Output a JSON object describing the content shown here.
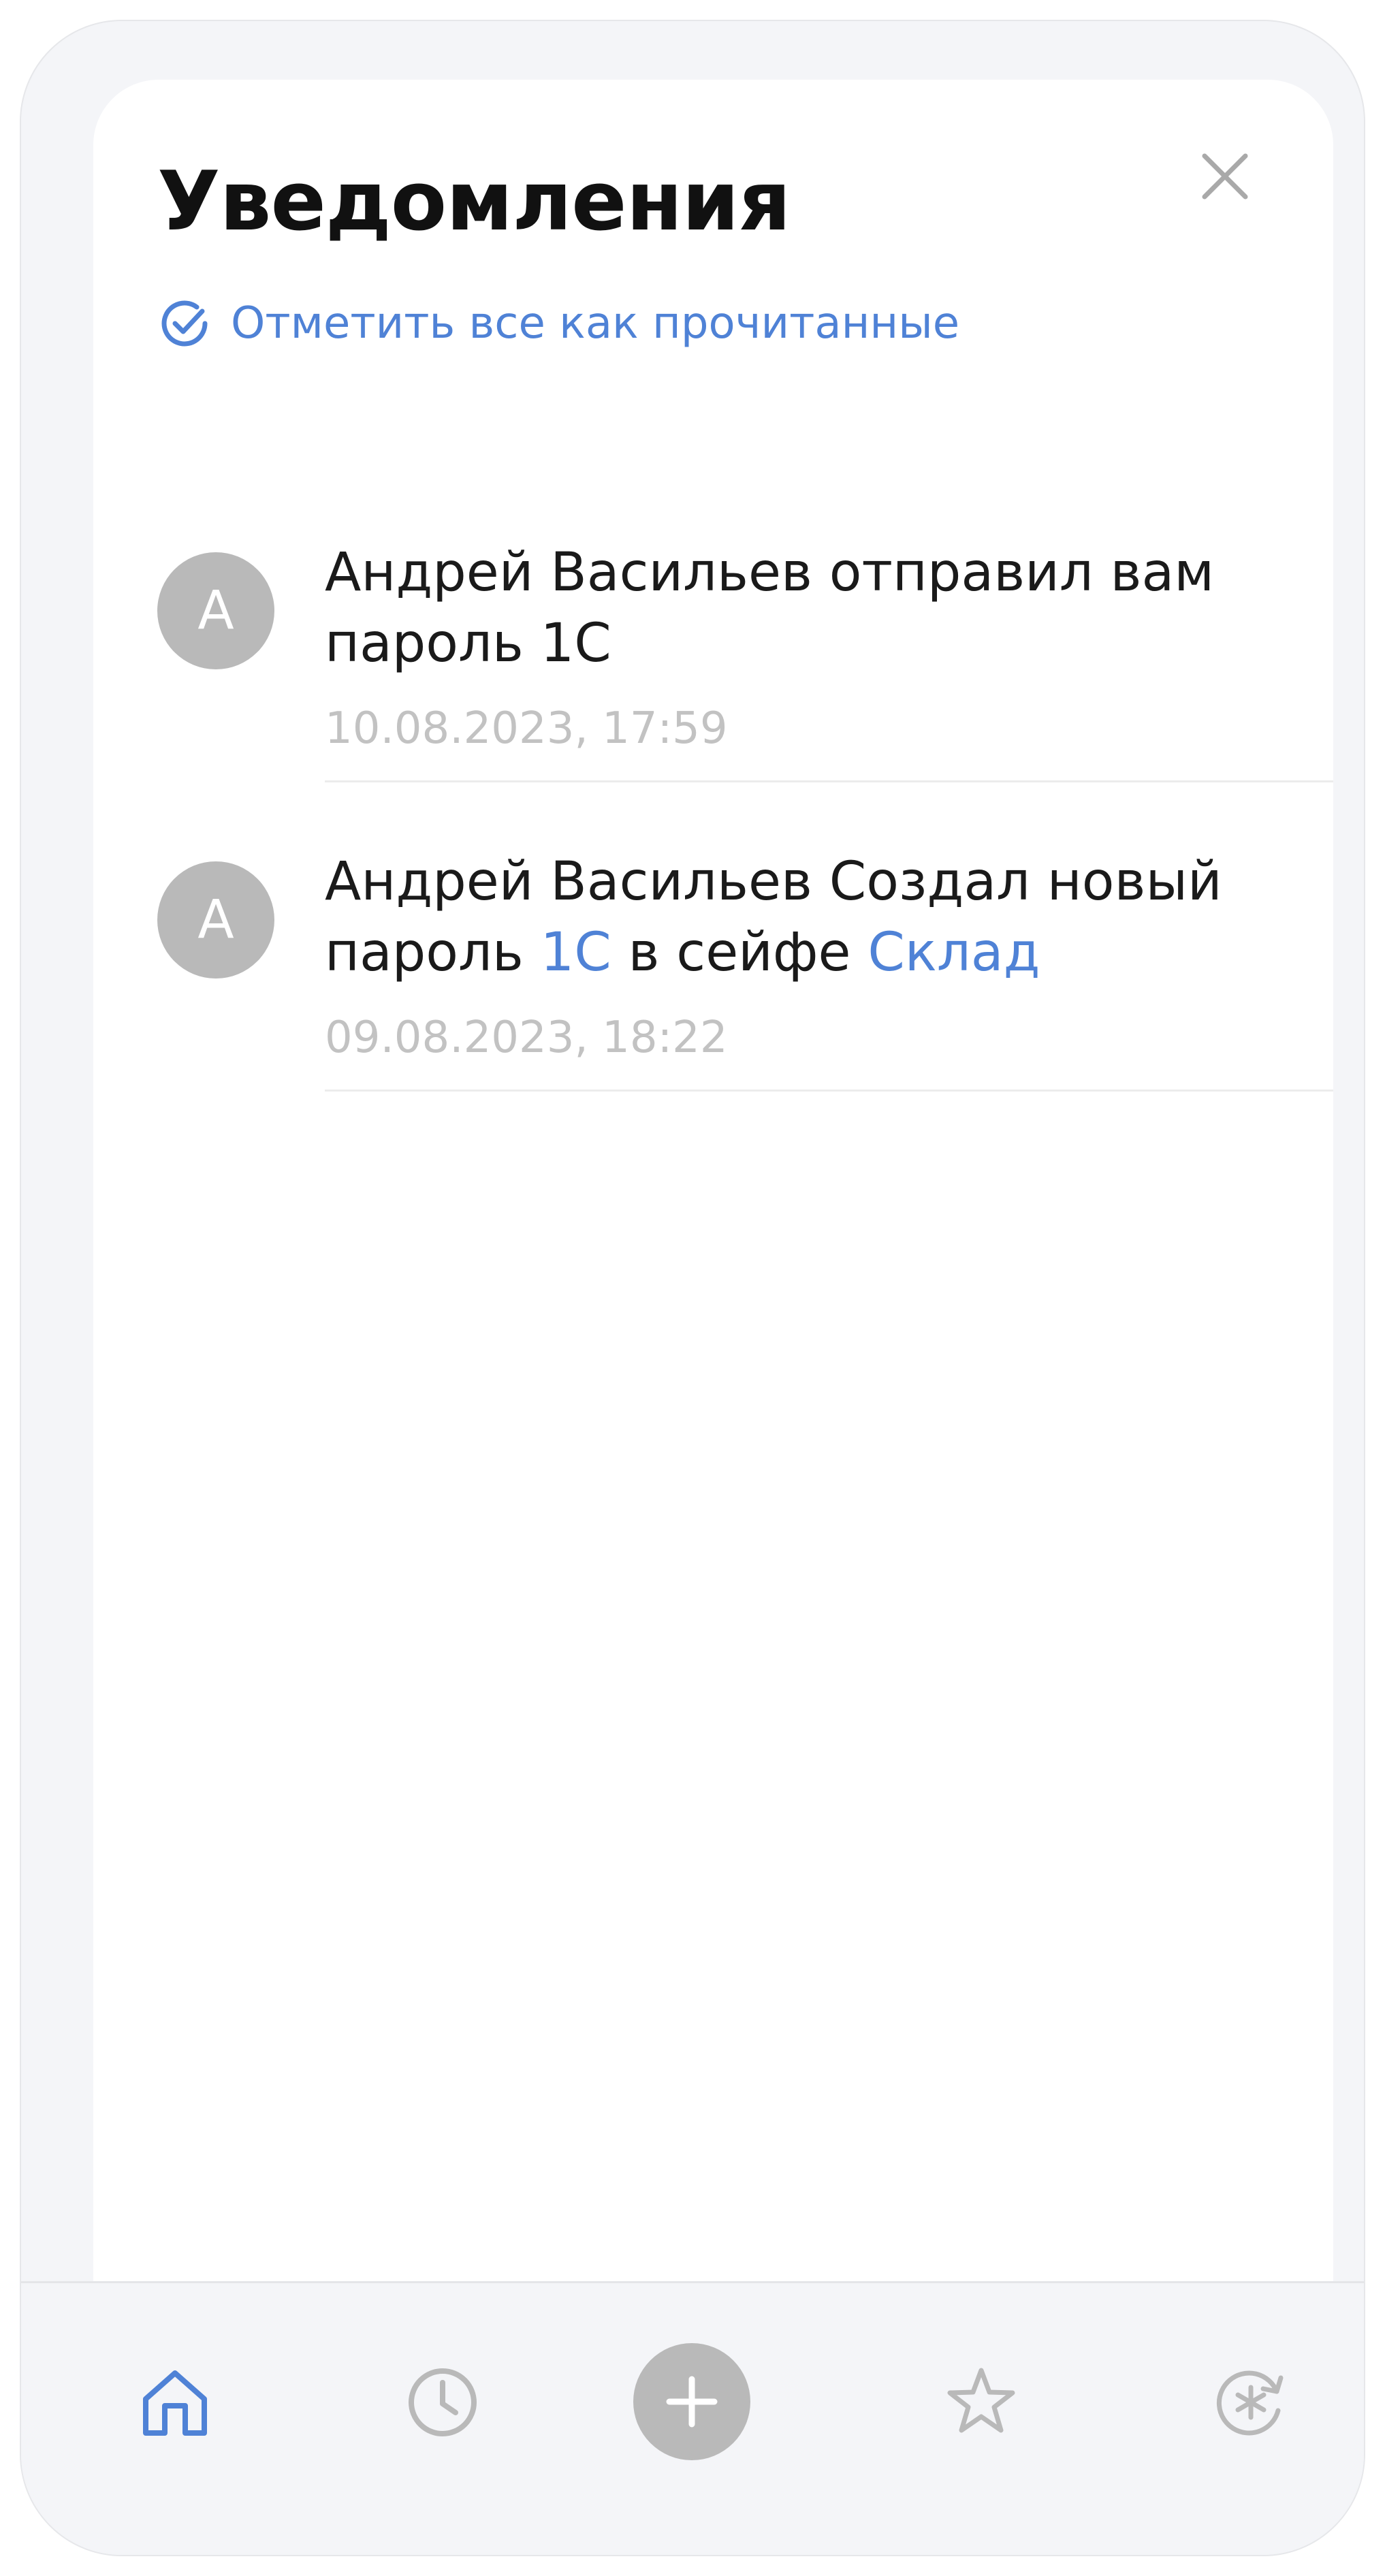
{
  "header": {
    "title": "Уведомления"
  },
  "actions": {
    "mark_all_read": "Отметить все как прочитанные"
  },
  "notifications": [
    {
      "avatar_letter": "А",
      "text_parts": [
        "Андрей Васильев отправил вам пароль 1С"
      ],
      "time": "10.08.2023, 17:59"
    },
    {
      "avatar_letter": "А",
      "text_before": "Андрей Васильев Создал новый пароль ",
      "link1": "1С",
      "text_middle": " в сейфе ",
      "link2": "Склад",
      "time": "09.08.2023, 18:22"
    }
  ],
  "colors": {
    "accent": "#4f82d6",
    "muted": "#b9b9b9"
  },
  "tabbar": {
    "icons": [
      "home-icon",
      "clock-icon",
      "plus-icon",
      "star-icon",
      "password-generator-icon"
    ],
    "active": "home-icon"
  }
}
